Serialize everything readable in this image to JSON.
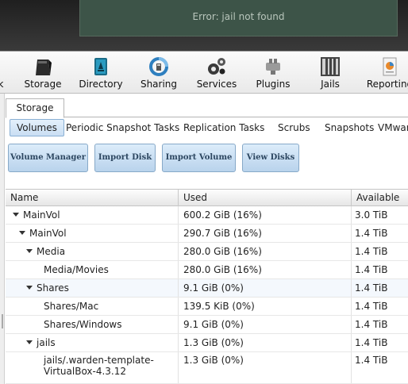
{
  "error": {
    "message": "Error: jail not found"
  },
  "toolbar": {
    "items": [
      {
        "label": "k",
        "icon": "account-icon"
      },
      {
        "label": "Storage",
        "icon": "storage-icon"
      },
      {
        "label": "Directory",
        "icon": "directory-icon"
      },
      {
        "label": "Sharing",
        "icon": "sharing-icon"
      },
      {
        "label": "Services",
        "icon": "services-icon"
      },
      {
        "label": "Plugins",
        "icon": "plugins-icon"
      },
      {
        "label": "Jails",
        "icon": "jails-icon"
      },
      {
        "label": "Reporting",
        "icon": "reporting-icon"
      }
    ]
  },
  "main_tab": {
    "label": "Storage"
  },
  "sub_tabs": [
    "Volumes",
    "Periodic Snapshot Tasks",
    "Replication Tasks",
    "Scrubs",
    "Snapshots",
    "VMwar"
  ],
  "buttons": [
    "Volume Manager",
    "Import Disk",
    "Import Volume",
    "View Disks"
  ],
  "table": {
    "columns": [
      "Name",
      "Used",
      "Available"
    ],
    "rows": [
      {
        "name": "MainVol",
        "used": "600.2 GiB (16%)",
        "available": "3.0 TiB"
      },
      {
        "name": "MainVol",
        "used": "290.7 GiB (16%)",
        "available": "1.4 TiB"
      },
      {
        "name": "Media",
        "used": "280.0 GiB (16%)",
        "available": "1.4 TiB"
      },
      {
        "name": "Media/Movies",
        "used": "280.0 GiB (16%)",
        "available": "1.4 TiB"
      },
      {
        "name": "Shares",
        "used": "9.1 GiB (0%)",
        "available": "1.4 TiB"
      },
      {
        "name": "Shares/Mac",
        "used": "139.5 KiB (0%)",
        "available": "1.4 TiB"
      },
      {
        "name": "Shares/Windows",
        "used": "9.1 GiB (0%)",
        "available": "1.4 TiB"
      },
      {
        "name": "jails",
        "used": "1.3 GiB (0%)",
        "available": "1.4 TiB"
      },
      {
        "name_line1": "jails/.warden-template-",
        "name_line2": "VirtualBox-4.3.12",
        "used": "1.3 GiB (0%)",
        "available": "1.4 TiB"
      }
    ]
  }
}
